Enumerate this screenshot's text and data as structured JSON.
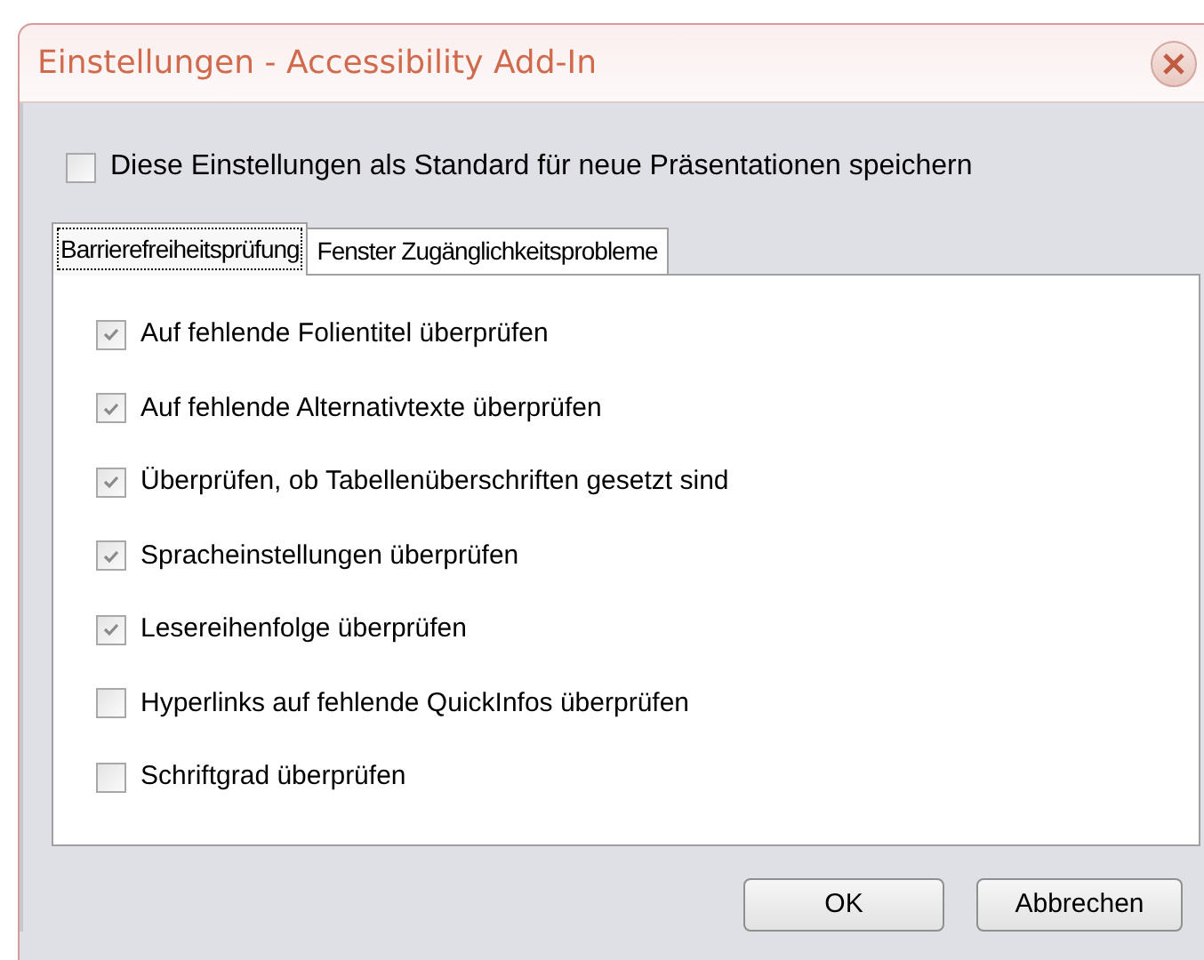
{
  "window": {
    "title": "Einstellungen - Accessibility Add-In"
  },
  "default_option": {
    "label": "Diese Einstellungen als Standard für neue Präsentationen speichern",
    "checked": false
  },
  "tabs": [
    {
      "label": "Barrierefreiheitsprüfung",
      "selected": true
    },
    {
      "label": "Fenster Zugänglichkeitsprobleme",
      "selected": false
    }
  ],
  "checks": [
    {
      "label": "Auf fehlende Folientitel überprüfen",
      "checked": true
    },
    {
      "label": "Auf fehlende Alternativtexte überprüfen",
      "checked": true
    },
    {
      "label": "Überprüfen, ob Tabellenüberschriften gesetzt sind",
      "checked": true
    },
    {
      "label": "Spracheinstellungen überprüfen",
      "checked": true
    },
    {
      "label": "Lesereihenfolge überprüfen",
      "checked": true
    },
    {
      "label": "Hyperlinks auf fehlende QuickInfos überprüfen",
      "checked": false
    },
    {
      "label": "Schriftgrad überprüfen",
      "checked": false
    }
  ],
  "buttons": [
    "OK",
    "Abbrechen"
  ]
}
